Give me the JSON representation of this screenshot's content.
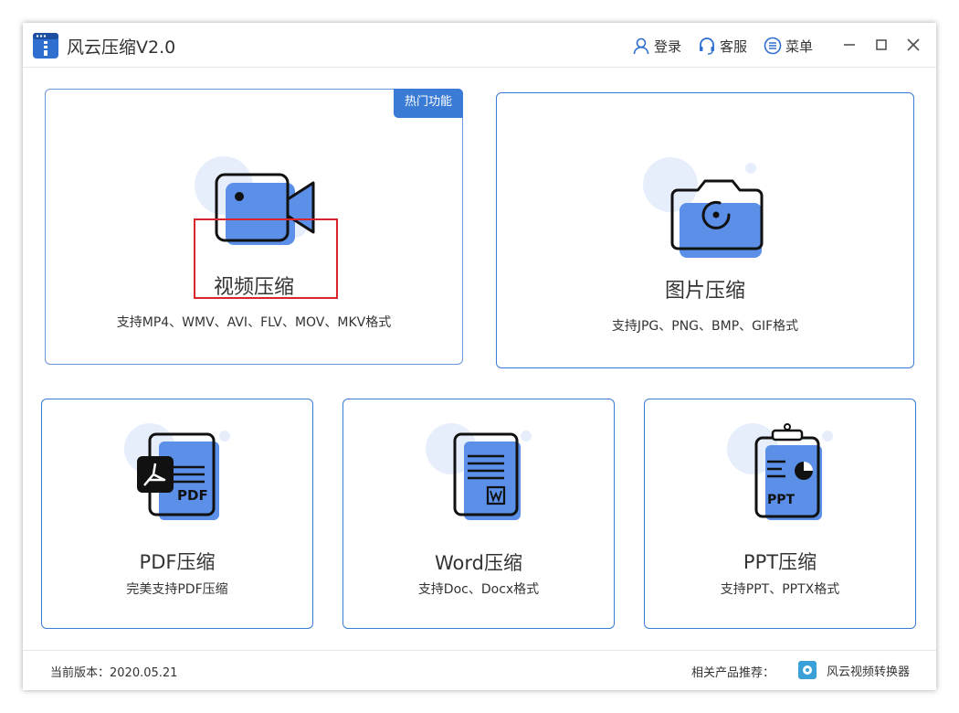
{
  "app": {
    "title": "风云压缩V2.0"
  },
  "titlebar": {
    "login": "登录",
    "service": "客服",
    "menu": "菜单"
  },
  "cards": {
    "video": {
      "badge": "热门功能",
      "title": "视频压缩",
      "sub": "支持MP4、WMV、AVI、FLV、MOV、MKV格式"
    },
    "image": {
      "title": "图片压缩",
      "sub": "支持JPG、PNG、BMP、GIF格式"
    },
    "pdf": {
      "title": "PDF压缩",
      "sub": "完美支持PDF压缩",
      "icon_text": "PDF"
    },
    "word": {
      "title": "Word压缩",
      "sub": "支持Doc、Docx格式"
    },
    "ppt": {
      "title": "PPT压缩",
      "sub": "支持PPT、PPTX格式",
      "icon_text": "PPT"
    }
  },
  "footer": {
    "version": "当前版本：2020.05.21",
    "related": "相关产品推荐：",
    "product": "风云视频转换器"
  },
  "colors": {
    "accent": "#3a7bd5",
    "icon_fill": "#5b8fe8",
    "icon_bg": "#e6eefc",
    "highlight": "#d9262c"
  }
}
